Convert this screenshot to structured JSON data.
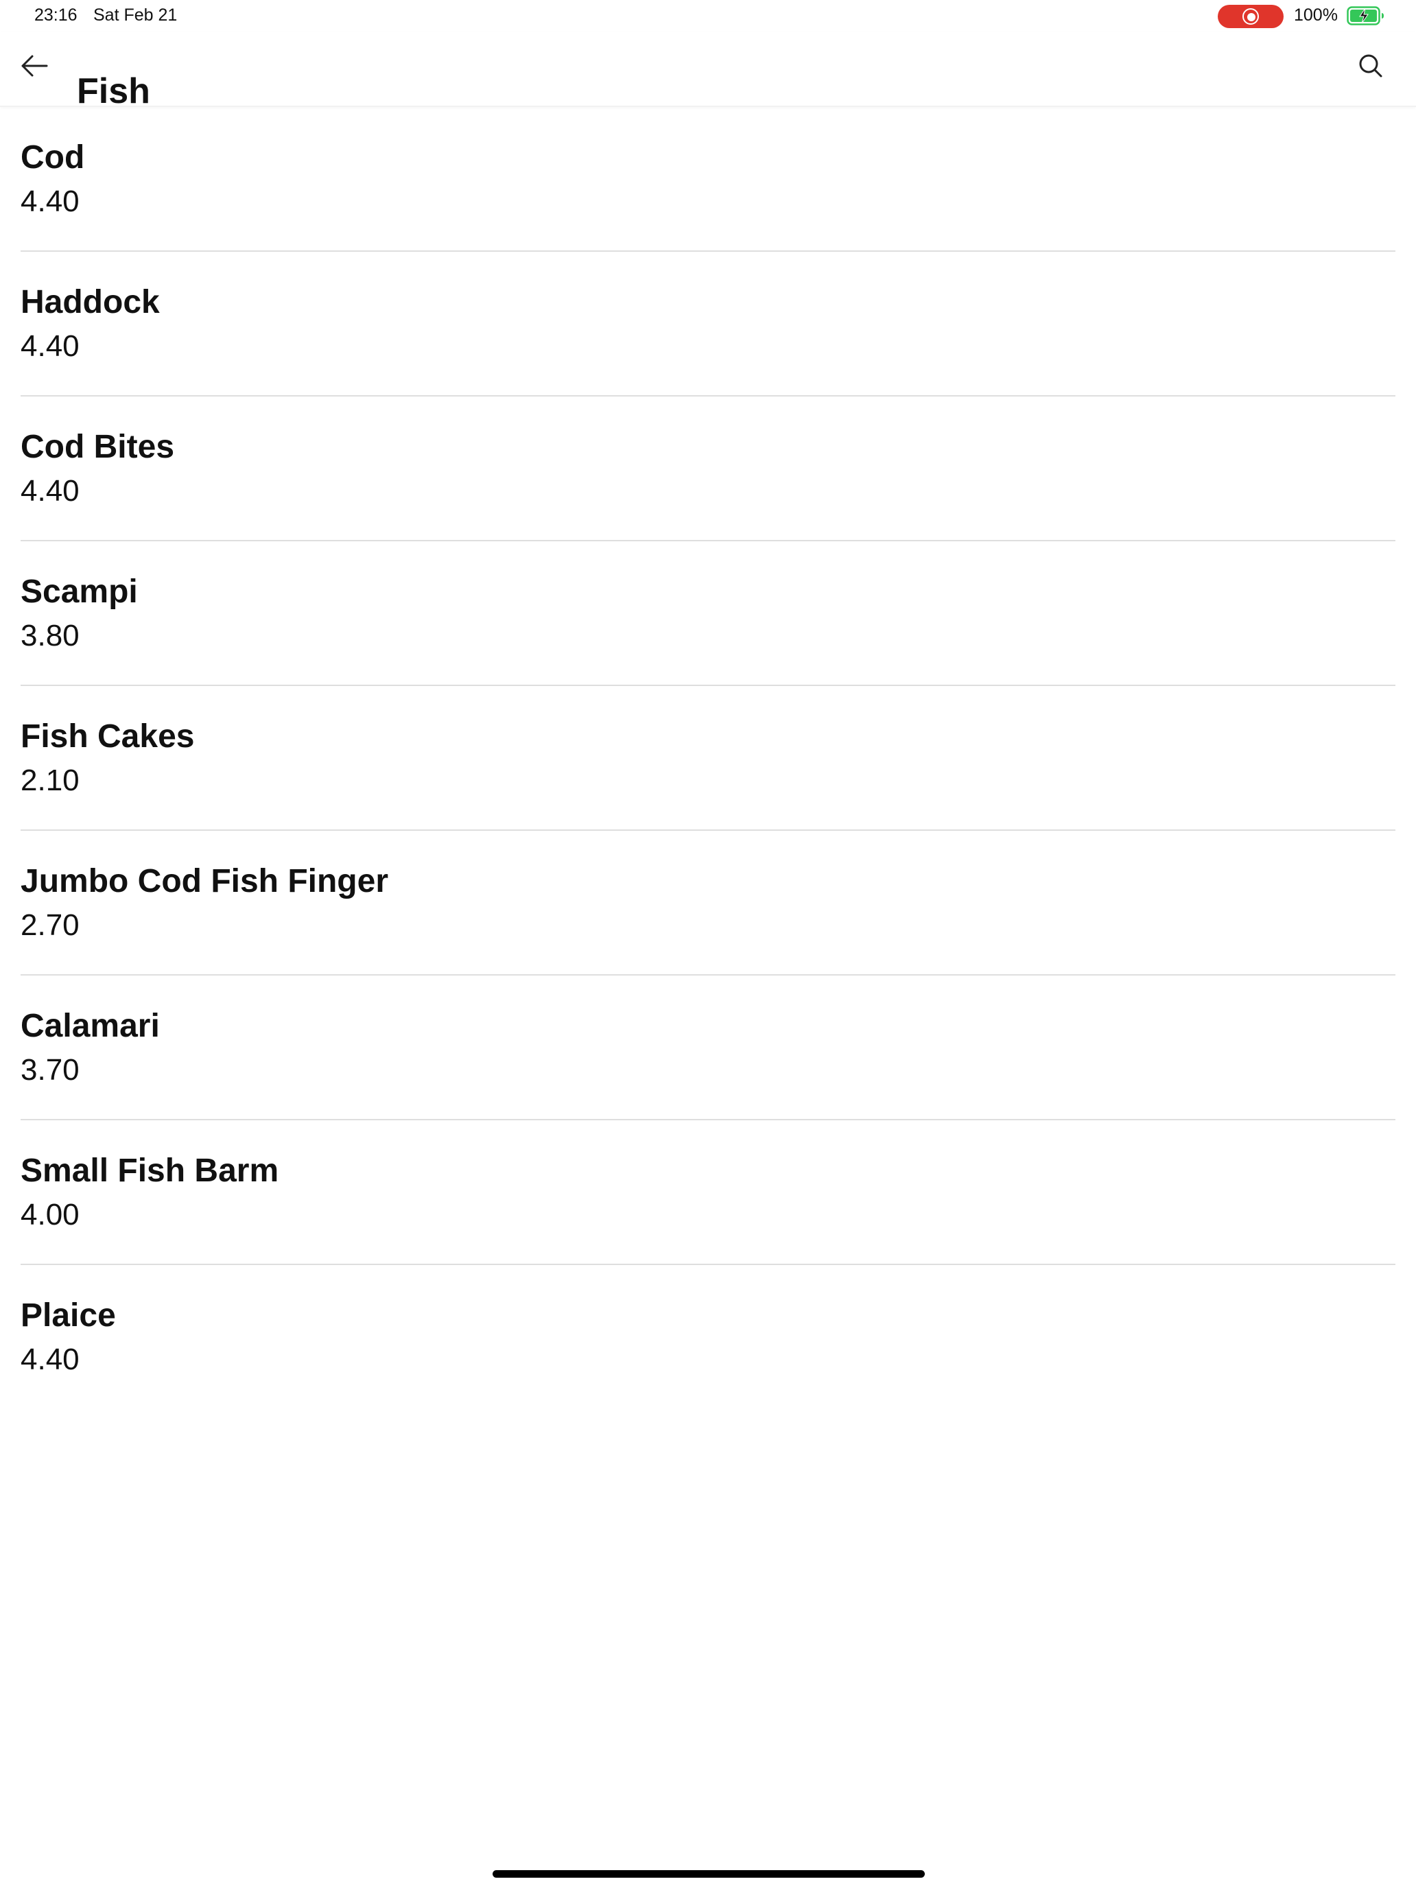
{
  "status_bar": {
    "time": "23:16",
    "date": "Sat Feb 21",
    "battery_percent": "100%",
    "battery_level": 1.0,
    "battery_charging": true,
    "recording_color": "#e0352b",
    "battery_color": "#34c759",
    "icons": [
      "screen-recording-icon",
      "battery-charging-icon"
    ]
  },
  "header": {
    "title": "Fish",
    "back_icon": "arrow-left-icon",
    "search_icon": "search-icon"
  },
  "items": [
    {
      "name": "Cod",
      "price": "4.40"
    },
    {
      "name": "Haddock",
      "price": "4.40"
    },
    {
      "name": "Cod Bites",
      "price": "4.40"
    },
    {
      "name": "Scampi",
      "price": "3.80"
    },
    {
      "name": "Fish Cakes",
      "price": "2.10"
    },
    {
      "name": "Jumbo Cod Fish Finger",
      "price": "2.70"
    },
    {
      "name": "Calamari",
      "price": "3.70"
    },
    {
      "name": "Small Fish Barm",
      "price": "4.00"
    },
    {
      "name": "Plaice",
      "price": "4.40"
    }
  ]
}
